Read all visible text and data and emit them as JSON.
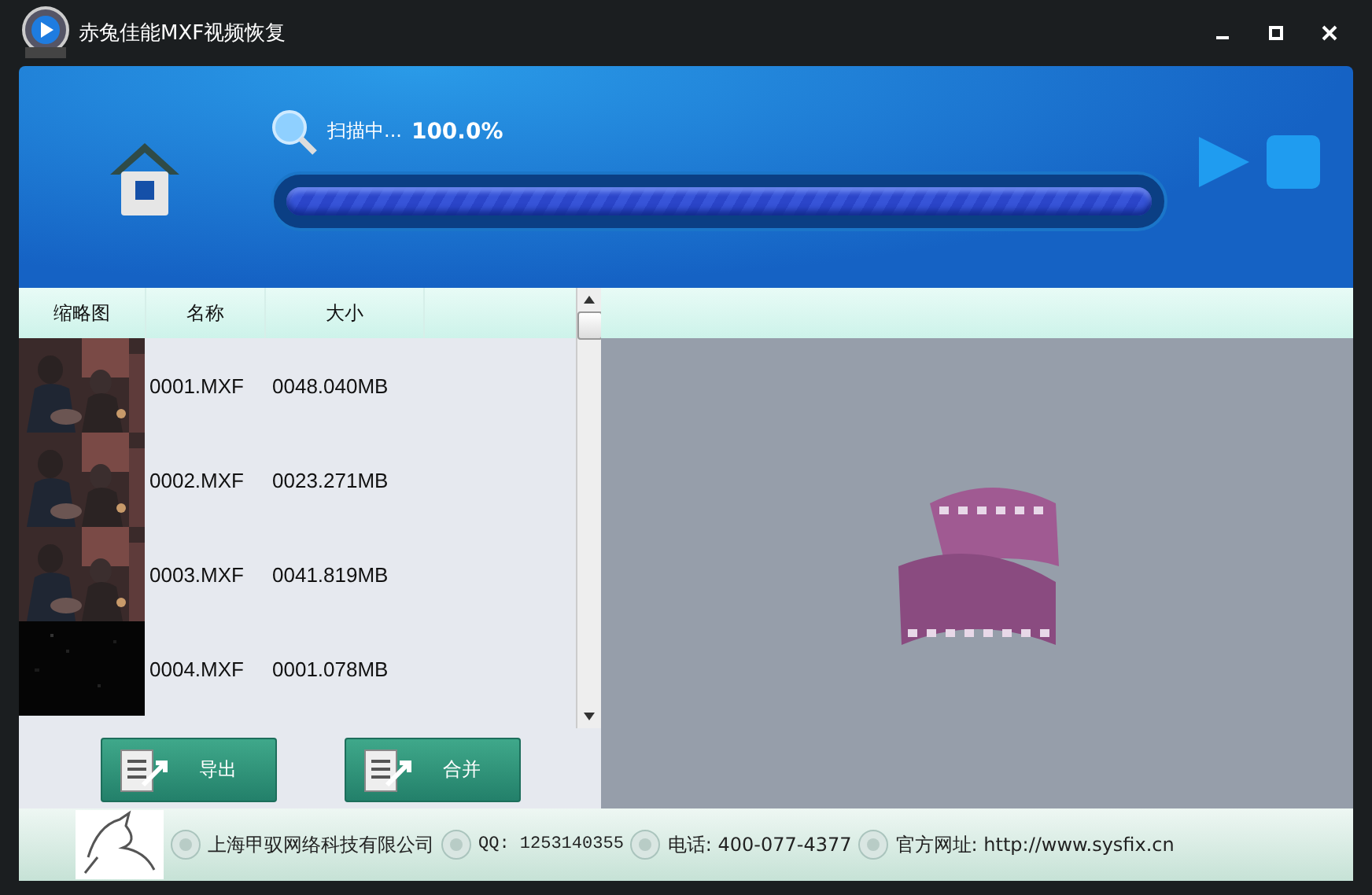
{
  "window": {
    "title": "赤兔佳能MXF视频恢复"
  },
  "scan": {
    "status": "扫描中...",
    "percent": "100.0%",
    "level": 1
  },
  "table": {
    "columns": [
      "缩略图",
      "名称",
      "大小"
    ],
    "rows": [
      {
        "name": "0001.MXF",
        "size": "0048.040MB",
        "kind": "scene"
      },
      {
        "name": "0002.MXF",
        "size": "0023.271MB",
        "kind": "scene"
      },
      {
        "name": "0003.MXF",
        "size": "0041.819MB",
        "kind": "scene"
      },
      {
        "name": "0004.MXF",
        "size": "0001.078MB",
        "kind": "dark"
      }
    ]
  },
  "buttons": [
    {
      "label": "导出"
    },
    {
      "label": "合并"
    }
  ],
  "footer": {
    "company": "上海甲驭网络科技有限公司",
    "qq": "QQ: 1253140355",
    "phone": "电话: 400-077-4377",
    "website": "官方网址: http://www.sysfix.cn"
  }
}
